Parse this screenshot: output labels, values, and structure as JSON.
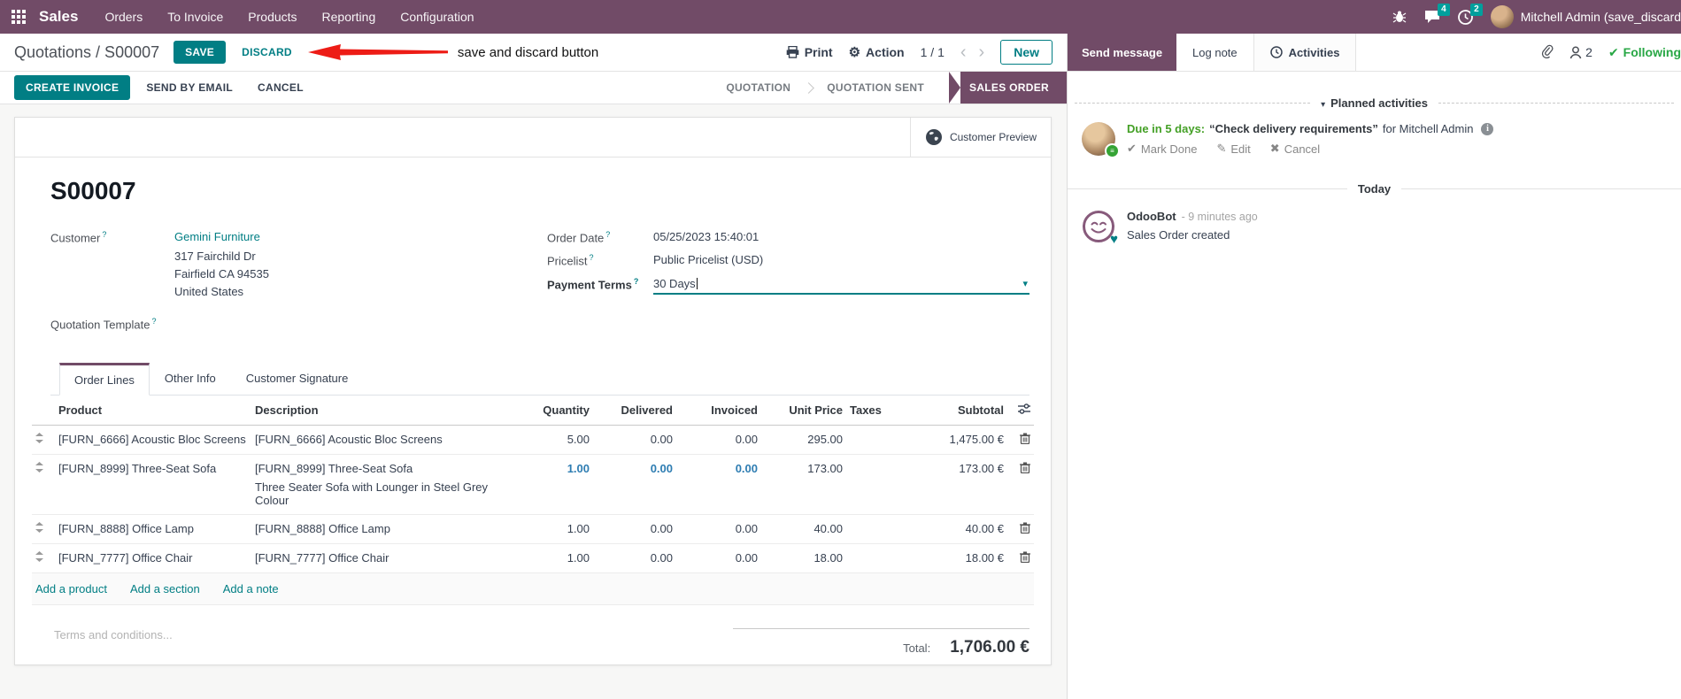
{
  "navbar": {
    "app_name": "Sales",
    "menus": [
      "Orders",
      "To Invoice",
      "Products",
      "Reporting",
      "Configuration"
    ],
    "messages_badge": "4",
    "activities_badge": "2",
    "user_name": "Mitchell Admin (save_discard"
  },
  "breadcrumb": {
    "path": "Quotations / S00007"
  },
  "controls": {
    "save": "SAVE",
    "discard": "DISCARD",
    "print": "Print",
    "action": "Action",
    "pager": "1 / 1",
    "new": "New"
  },
  "annotation": {
    "text": "save and discard button"
  },
  "actions": {
    "create_invoice": "CREATE INVOICE",
    "send_by_email": "SEND BY EMAIL",
    "cancel": "CANCEL"
  },
  "statusbar": {
    "stage1": "QUOTATION",
    "stage2": "QUOTATION SENT",
    "active": "SALES ORDER"
  },
  "form": {
    "reference": "S00007",
    "customer_preview": "Customer Preview",
    "customer_label": "Customer",
    "customer_name": "Gemini Furniture",
    "address_line1": "317 Fairchild Dr",
    "address_line2": "Fairfield CA 94535",
    "address_line3": "United States",
    "quotation_template_label": "Quotation Template",
    "order_date_label": "Order Date",
    "order_date_value": "05/25/2023 15:40:01",
    "pricelist_label": "Pricelist",
    "pricelist_value": "Public Pricelist (USD)",
    "payment_terms_label": "Payment Terms",
    "payment_terms_value": "30 Days",
    "tabs": {
      "order_lines": "Order Lines",
      "other_info": "Other Info",
      "customer_signature": "Customer Signature"
    },
    "table": {
      "headers": {
        "product": "Product",
        "description": "Description",
        "quantity": "Quantity",
        "delivered": "Delivered",
        "invoiced": "Invoiced",
        "unit_price": "Unit Price",
        "taxes": "Taxes",
        "subtotal": "Subtotal"
      },
      "rows": [
        {
          "product": "[FURN_6666] Acoustic Bloc Screens",
          "description": "[FURN_6666] Acoustic Bloc Screens",
          "description2": "",
          "quantity": "5.00",
          "delivered": "0.00",
          "invoiced": "0.00",
          "unit_price": "295.00",
          "taxes": "",
          "subtotal": "1,475.00 €"
        },
        {
          "product": "[FURN_8999] Three-Seat Sofa",
          "description": "[FURN_8999] Three-Seat Sofa",
          "description2": "Three Seater Sofa with Lounger in Steel Grey Colour",
          "quantity": "1.00",
          "delivered": "0.00",
          "invoiced": "0.00",
          "unit_price": "173.00",
          "taxes": "",
          "subtotal": "173.00 €"
        },
        {
          "product": "[FURN_8888] Office Lamp",
          "description": "[FURN_8888] Office Lamp",
          "description2": "",
          "quantity": "1.00",
          "delivered": "0.00",
          "invoiced": "0.00",
          "unit_price": "40.00",
          "taxes": "",
          "subtotal": "40.00 €"
        },
        {
          "product": "[FURN_7777] Office Chair",
          "description": "[FURN_7777] Office Chair",
          "description2": "",
          "quantity": "1.00",
          "delivered": "0.00",
          "invoiced": "0.00",
          "unit_price": "18.00",
          "taxes": "",
          "subtotal": "18.00 €"
        }
      ],
      "links": {
        "add_product": "Add a product",
        "add_section": "Add a section",
        "add_note": "Add a note"
      }
    },
    "terms_placeholder": "Terms and conditions...",
    "total_label": "Total:",
    "total_value": "1,706.00 €"
  },
  "chatter": {
    "send_message": "Send message",
    "log_note": "Log note",
    "activities": "Activities",
    "followers_count": "2",
    "following": "Following",
    "planned_title": "Planned activities",
    "activity": {
      "due": "Due in 5 days:",
      "summary": "“Check delivery requirements”",
      "assignee": "for Mitchell Admin",
      "mark_done": "Mark Done",
      "edit": "Edit",
      "cancel": "Cancel"
    },
    "today": "Today",
    "message": {
      "author": "OdooBot",
      "time": "- 9 minutes ago",
      "body": "Sales Order created"
    }
  },
  "icons": {
    "gear": "⚙",
    "chevron-left": "‹",
    "chevron-right": "›",
    "caret-down": "▾",
    "collapse-caret": "▾",
    "check": "✔",
    "pencil": "✎",
    "cross": "✖",
    "heart": "♥",
    "badge-lines": "≡"
  },
  "colors": {
    "brand_purple": "#714B67",
    "primary_teal": "#017E84",
    "badge_teal": "#00A09D",
    "dirty_blue": "#2e7db2",
    "green": "#28a745",
    "due_green": "#44a026",
    "arrow_red": "#ed1c16"
  }
}
